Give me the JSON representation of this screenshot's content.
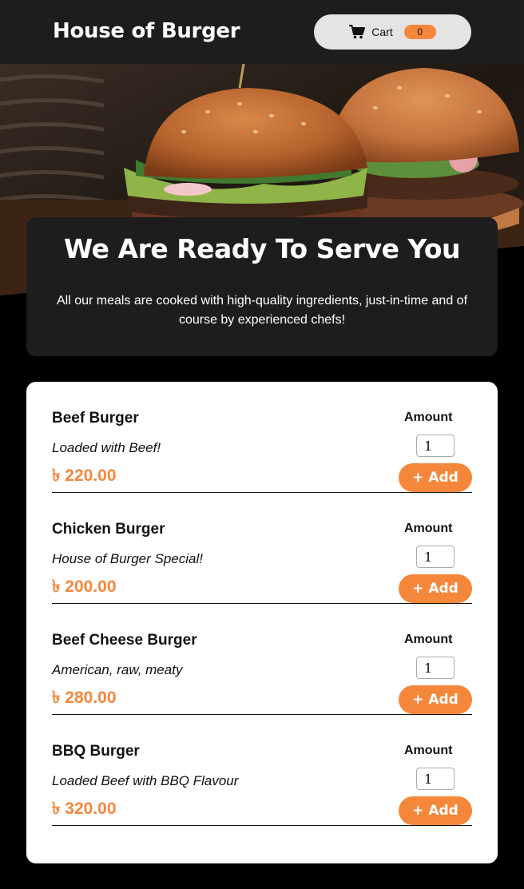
{
  "header": {
    "brand": "House of Burger",
    "cart": {
      "label": "Cart",
      "count": "0"
    }
  },
  "intro": {
    "title": "We Are Ready To Serve You",
    "text": "All our meals are cooked with high-quality ingredients, just-in-time and of course by experienced chefs!"
  },
  "menu": {
    "amount_label": "Amount",
    "add_label": "+ Add",
    "meals": [
      {
        "name": "Beef Burger",
        "description": "Loaded with Beef!",
        "price": "৳ 220.00",
        "amount": "1"
      },
      {
        "name": "Chicken Burger",
        "description": "House of Burger Special!",
        "price": "৳ 200.00",
        "amount": "1"
      },
      {
        "name": "Beef Cheese Burger",
        "description": "American, raw, meaty",
        "price": "৳ 280.00",
        "amount": "1"
      },
      {
        "name": "BBQ Burger",
        "description": "Loaded Beef with BBQ Flavour",
        "price": "৳ 320.00",
        "amount": "1"
      }
    ]
  },
  "colors": {
    "accent": "#f5873b",
    "header_bg": "#1d1d1d",
    "page_bg": "#000000"
  },
  "icons": {
    "cart": "cart-icon"
  }
}
